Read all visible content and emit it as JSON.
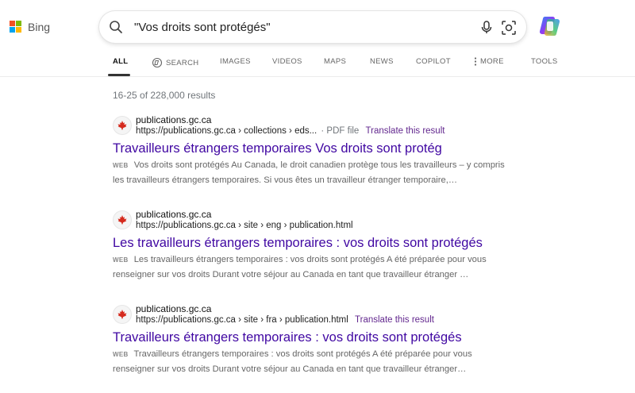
{
  "brand": {
    "name": "Bing"
  },
  "search": {
    "query": "\"Vos droits sont protégés\""
  },
  "tabs": [
    {
      "label": "ALL",
      "icon": ""
    },
    {
      "label": "SEARCH",
      "icon": "copilot-search-icon"
    },
    {
      "label": "IMAGES",
      "icon": ""
    },
    {
      "label": "VIDEOS",
      "icon": ""
    },
    {
      "label": "MAPS",
      "icon": ""
    },
    {
      "label": "NEWS",
      "icon": ""
    },
    {
      "label": "COPILOT",
      "icon": ""
    },
    {
      "label": "MORE",
      "icon": "more-vertical-icon"
    },
    {
      "label": "TOOLS",
      "icon": ""
    }
  ],
  "results_count": "16-25 of 228,000 results",
  "results": [
    {
      "site": "publications.gc.ca",
      "url": "https://publications.gc.ca › collections › eds...",
      "file_type": "· PDF file",
      "translate": "Translate this result",
      "title": "Travailleurs étrangers temporaires Vos droits sont protég",
      "badge": "WEB",
      "snippet": "Vos droits sont protégés Au Canada, le droit canadien protège tous les travailleurs – y compris les travailleurs étrangers temporaires. Si vous êtes un travailleur étranger temporaire,…"
    },
    {
      "site": "publications.gc.ca",
      "url": "https://publications.gc.ca › site › eng › publication.html",
      "file_type": "",
      "translate": "",
      "title": "Les travailleurs étrangers temporaires : vos droits sont protégés",
      "badge": "WEB",
      "snippet": "Les travailleurs étrangers temporaires : vos droits sont protégés A été préparée pour vous renseigner sur vos droits Durant votre séjour au Canada en tant que travailleur étranger …"
    },
    {
      "site": "publications.gc.ca",
      "url": "https://publications.gc.ca › site › fra › publication.html",
      "file_type": "",
      "translate": "Translate this result",
      "title": "Travailleurs étrangers temporaires : vos droits sont protégés",
      "badge": "WEB",
      "snippet": "Travailleurs étrangers temporaires : vos droits sont protégés A été préparée pour vous renseigner sur vos droits Durant votre séjour au Canada en tant que travailleur étranger…"
    }
  ],
  "colors": {
    "title_link": "#4007a2",
    "translate_link": "#62278e",
    "ms_red": "#f25022",
    "ms_green": "#7fba00",
    "ms_blue": "#00a4ef",
    "ms_yellow": "#ffb900",
    "maple_red": "#d52b1e"
  }
}
